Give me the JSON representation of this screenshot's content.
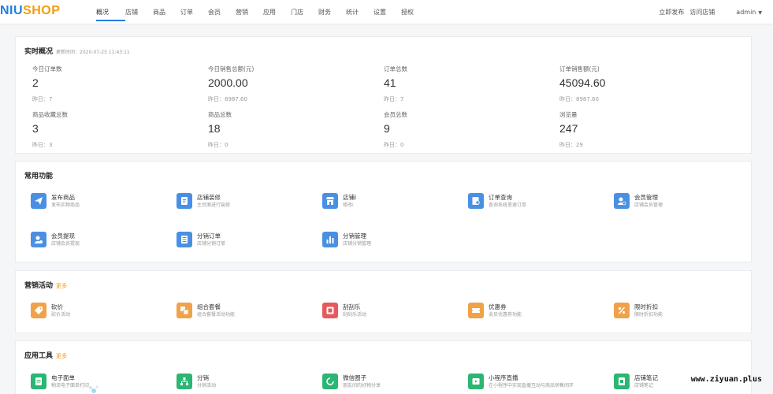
{
  "logo": {
    "part1": "NIU",
    "part2": "SHOP"
  },
  "nav": [
    {
      "label": "概况",
      "active": true
    },
    {
      "label": "店铺"
    },
    {
      "label": "商品"
    },
    {
      "label": "订单"
    },
    {
      "label": "会员"
    },
    {
      "label": "营销"
    },
    {
      "label": "应用"
    },
    {
      "label": "门店"
    },
    {
      "label": "财务"
    },
    {
      "label": "统计"
    },
    {
      "label": "设置"
    },
    {
      "label": "授权"
    }
  ],
  "topright": {
    "publish": "立即发布",
    "visit": "访问店铺",
    "user": "admin"
  },
  "realtime": {
    "title": "实时概况",
    "updated": "更新时间：2020-07-25 11:43:11",
    "stats": [
      {
        "label": "今日订单数",
        "value": "2",
        "yesterday": "昨日：7"
      },
      {
        "label": "今日销售总额(元)",
        "value": "2000.00",
        "yesterday": "昨日：8987.60"
      },
      {
        "label": "订单总数",
        "value": "41",
        "yesterday": "昨日：7"
      },
      {
        "label": "订单销售额(元)",
        "value": "45094.60",
        "yesterday": "昨日：8987.60"
      },
      {
        "label": "商品收藏总数",
        "value": "3",
        "yesterday": "昨日：3"
      },
      {
        "label": "商品总数",
        "value": "18",
        "yesterday": "昨日：0"
      },
      {
        "label": "会员总数",
        "value": "9",
        "yesterday": "昨日：0"
      },
      {
        "label": "浏览量",
        "value": "247",
        "yesterday": "昨日：29"
      }
    ]
  },
  "common": {
    "title": "常用功能",
    "items": [
      {
        "title": "发布商品",
        "desc": "发布实物商品",
        "icon": "send-icon",
        "color": "#4a90e2"
      },
      {
        "title": "店铺装修",
        "desc": "主页面进行装修",
        "icon": "document-edit-icon",
        "color": "#4a90e2"
      },
      {
        "title": "店铺i",
        "desc": "修改i",
        "icon": "store-icon",
        "color": "#4a90e2"
      },
      {
        "title": "订单查询",
        "desc": "查询系统里速订单",
        "icon": "order-search-icon",
        "color": "#4a90e2"
      },
      {
        "title": "会员管理",
        "desc": "店铺会员管理",
        "icon": "member-manage-icon",
        "color": "#4a90e2"
      },
      {
        "title": "会员提现",
        "desc": "店铺会员提现",
        "icon": "member-withdraw-icon",
        "color": "#4a90e2"
      },
      {
        "title": "分销订单",
        "desc": "店铺分销订单",
        "icon": "list-icon",
        "color": "#4a90e2"
      },
      {
        "title": "分销管理",
        "desc": "店铺分销管理",
        "icon": "chart-icon",
        "color": "#4a90e2"
      }
    ]
  },
  "marketing": {
    "title": "营销活动",
    "more": "更多",
    "items": [
      {
        "title": "砍价",
        "desc": "砍价活动",
        "icon": "tag-icon",
        "color": "#f0a24a"
      },
      {
        "title": "组合套餐",
        "desc": "组合套餐活动功能",
        "icon": "bundle-icon",
        "color": "#f0a24a"
      },
      {
        "title": "刮刮乐",
        "desc": "刮刮乐活动",
        "icon": "scratch-icon",
        "color": "#e55a5a"
      },
      {
        "title": "优惠券",
        "desc": "会员优惠券功能",
        "icon": "ticket-icon",
        "color": "#f0a24a"
      },
      {
        "title": "限时折扣",
        "desc": "限时折扣功能",
        "icon": "percent-icon",
        "color": "#f0a24a"
      }
    ]
  },
  "tools": {
    "title": "应用工具",
    "more": "更多",
    "items": [
      {
        "title": "电子面单",
        "desc": "物流电子面单打印",
        "icon": "waybill-icon",
        "color": "#2bb673"
      },
      {
        "title": "分销",
        "desc": "分销活动",
        "icon": "tree-icon",
        "color": "#2bb673"
      },
      {
        "title": "微信圈子",
        "desc": "朋友间的好物分享",
        "icon": "circle-icon",
        "color": "#2bb673"
      },
      {
        "title": "小程序直播",
        "desc": "在小程序中实现直播互动与商品销售闭环",
        "icon": "live-icon",
        "color": "#2bb673"
      },
      {
        "title": "店铺笔记",
        "desc": "店铺笔记",
        "icon": "note-icon",
        "color": "#2bb673"
      }
    ]
  },
  "watermark": "www.ziyuan.plus"
}
